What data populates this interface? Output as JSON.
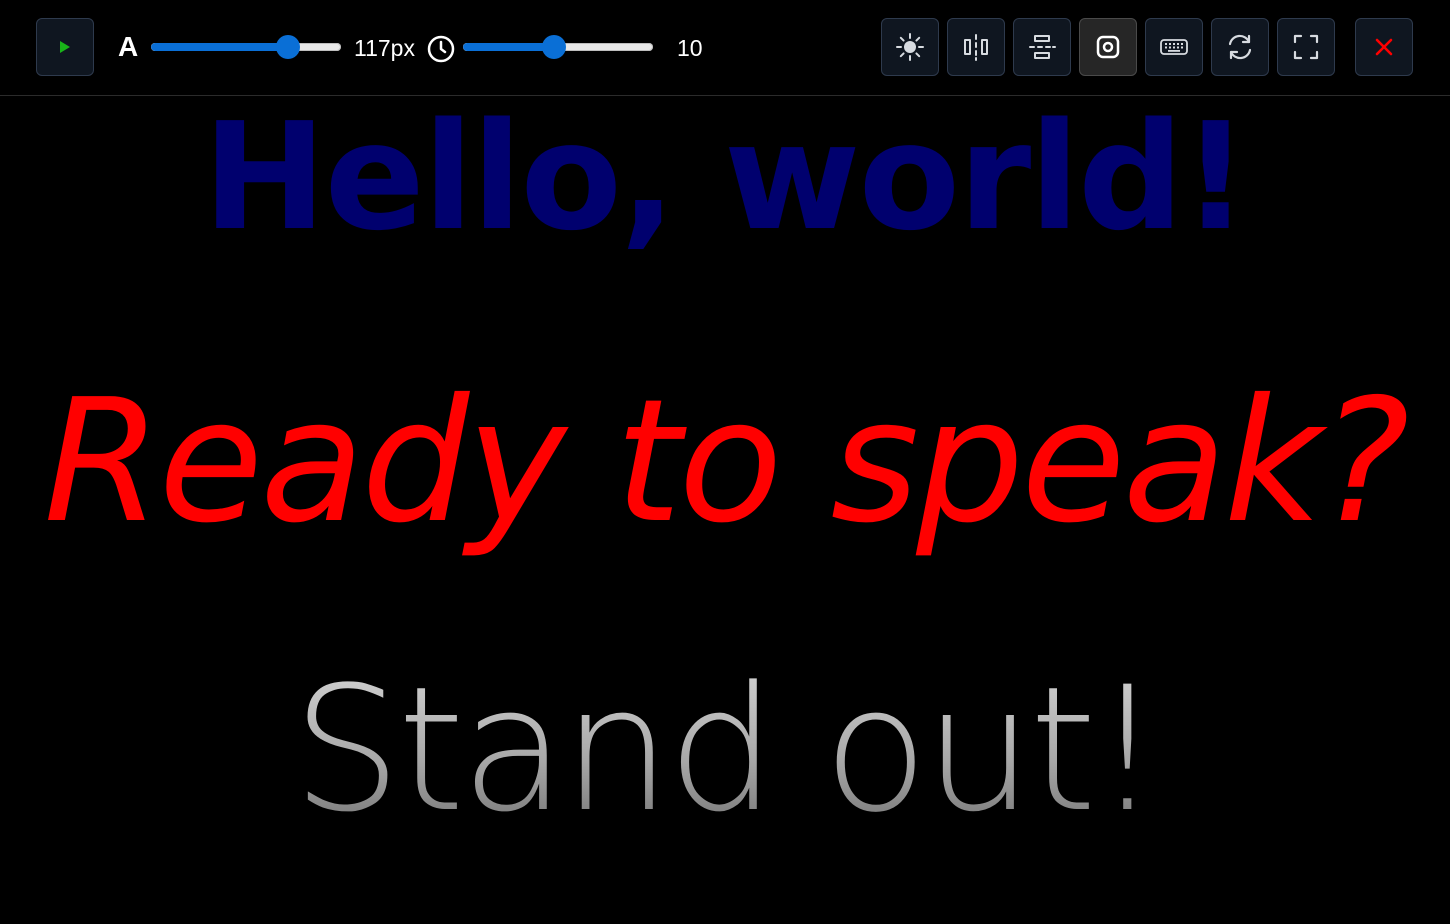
{
  "toolbar": {
    "font_size_icon_letter": "A",
    "font_size_value": "117px",
    "font_size_fraction": 0.72,
    "speed_value": "10",
    "speed_fraction": 0.48,
    "icons": {
      "play": "play-icon",
      "font_size": "letter-a-icon",
      "speed": "clock-icon",
      "brightness": "sun-icon",
      "mirror_horizontal": "flip-horizontal-icon",
      "mirror_vertical": "flip-vertical-icon",
      "camera": "camera-icon",
      "keyboard": "keyboard-icon",
      "reset": "refresh-icon",
      "fullscreen": "fullscreen-icon",
      "close": "close-icon"
    },
    "colors": {
      "accent": "#0a6fd6",
      "play": "#19b319",
      "close": "#ff0000"
    }
  },
  "script": {
    "lines": [
      {
        "text": "Hello, world!",
        "color": "#00006e"
      },
      {
        "text": "Ready to speak?",
        "color": "#ff0000"
      },
      {
        "text": "Stand out!",
        "color": "#b0b0b0"
      }
    ]
  }
}
